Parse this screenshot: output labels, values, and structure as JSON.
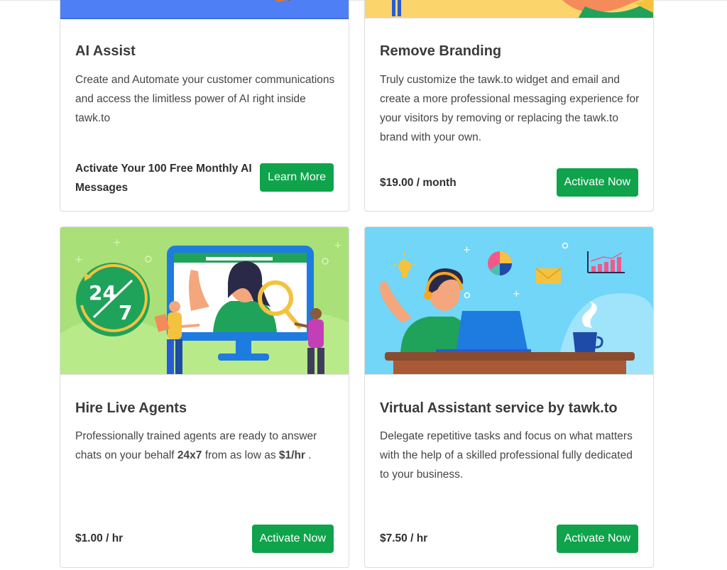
{
  "cards": [
    {
      "title": "AI Assist",
      "description": "Create and Automate your customer communications and access the limitless power of AI right inside tawk.to",
      "footer": "Activate Your 100 Free Monthly AI Messages",
      "button": "Learn More"
    },
    {
      "title": "Remove Branding",
      "description": "Truly customize the tawk.to widget and email and create a more professional messaging experience for your visitors by removing or replacing the tawk.to brand with your own.",
      "footer": "$19.00 / month",
      "button": "Activate Now"
    },
    {
      "title": "Hire Live Agents",
      "description_parts": [
        "Professionally trained agents are ready to answer chats on your behalf ",
        "24x7",
        " from as low as ",
        "$1/hr",
        " ."
      ],
      "footer": "$1.00 / hr",
      "button": "Activate Now",
      "badge": "24/7"
    },
    {
      "title": "Virtual Assistant service by tawk.to",
      "description": "Delegate repetitive tasks and focus on what matters with the help of a skilled professional fully dedicated to your business.",
      "footer": "$7.50 / hr",
      "button": "Activate Now"
    }
  ],
  "colors": {
    "accent_green": "#0fa34b",
    "banner_blue": "#4e7ff5",
    "banner_yellow": "#fbd46c",
    "banner_green": "#a9e078",
    "banner_sky": "#71d6f8"
  },
  "icons": [
    "monitor-agent-illustration",
    "clock-24-7-icon",
    "magnifier-icon",
    "lightbulb-icon",
    "pie-chart-icon",
    "envelope-icon",
    "bar-chart-icon",
    "laptop-icon",
    "coffee-cup-icon"
  ]
}
